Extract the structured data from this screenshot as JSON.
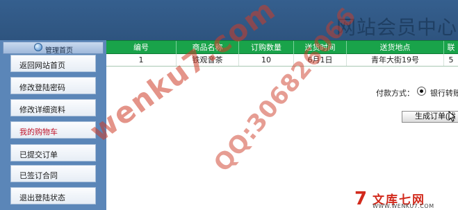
{
  "header": {
    "title": "网站会员中心"
  },
  "sidebar": {
    "heading": "管理首页",
    "items": [
      {
        "label": "返回网站首页"
      },
      {
        "label": "修改登陆密码"
      },
      {
        "label": "修改详细资料"
      },
      {
        "label": "我的购物车",
        "active": true
      },
      {
        "label": "已提交订单"
      },
      {
        "label": "已签订合同"
      },
      {
        "label": "退出登陆状态"
      }
    ]
  },
  "table": {
    "columns": [
      "编号",
      "商品名称",
      "订购数量",
      "送货时间",
      "送货地点",
      "联"
    ],
    "rows": [
      [
        "1",
        "铁观音茶",
        "10",
        "6月1日",
        "青年大街19号",
        "5"
      ]
    ],
    "header_color": "#19a34a"
  },
  "payment": {
    "label": "付款方式：",
    "option": "银行转账",
    "selected": true
  },
  "actions": {
    "generate_order": "生成订单(状"
  },
  "watermarks": [
    "wenku7.com",
    "QQ:306826066"
  ],
  "logo": {
    "mark": "7",
    "name": "文库七网",
    "url": "WWW.WENKU7.COM"
  }
}
